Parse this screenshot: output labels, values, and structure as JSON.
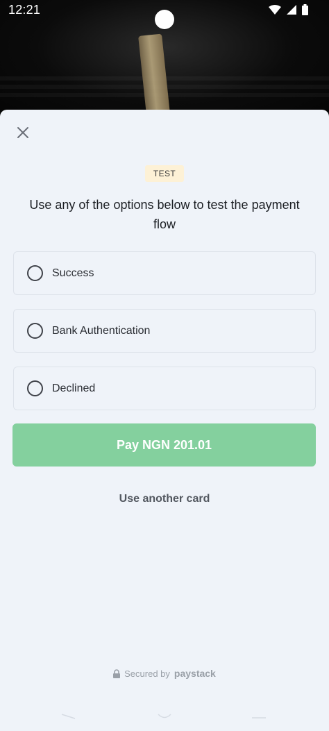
{
  "status_bar": {
    "time": "12:21",
    "icons": [
      "wifi-icon",
      "signal-icon",
      "battery-icon"
    ]
  },
  "sheet": {
    "close_icon": "close-icon",
    "badge": "TEST",
    "title": "Use any of the options below to test the payment flow",
    "options": [
      {
        "label": "Success",
        "selected": false
      },
      {
        "label": "Bank Authentication",
        "selected": false
      },
      {
        "label": "Declined",
        "selected": false
      }
    ],
    "pay_button": "Pay NGN 201.01",
    "another_card": "Use another card",
    "footer": {
      "lock_icon": "lock-icon",
      "secured_text": "Secured by",
      "brand": "paystack"
    }
  },
  "colors": {
    "sheet_bg": "#eff3f9",
    "pay_button": "#84d09e",
    "badge_bg": "#fdf1d6",
    "text_dark": "#1b1e23"
  }
}
